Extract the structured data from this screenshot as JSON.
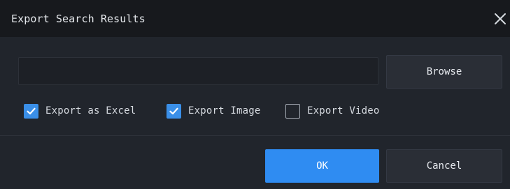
{
  "dialog": {
    "title": "Export Search Results",
    "close_icon": "close-icon"
  },
  "path_field": {
    "value": "",
    "placeholder": ""
  },
  "browse_label": "Browse",
  "options": [
    {
      "label": "Export as Excel",
      "checked": true
    },
    {
      "label": "Export Image",
      "checked": true
    },
    {
      "label": "Export Video",
      "checked": false
    }
  ],
  "footer": {
    "ok_label": "OK",
    "cancel_label": "Cancel"
  },
  "colors": {
    "accent": "#2f8cf2",
    "checkbox_checked": "#3a8fe8",
    "background": "#21252c",
    "titlebar": "#17191d"
  }
}
